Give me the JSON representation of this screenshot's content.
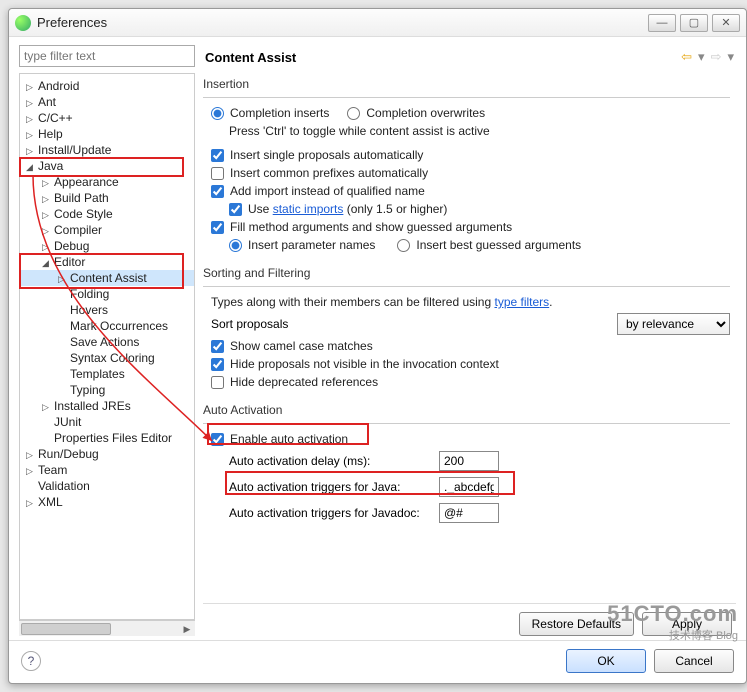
{
  "window": {
    "title": "Preferences"
  },
  "filter_placeholder": "type filter text",
  "tree": [
    {
      "label": "Android",
      "lvl": 0,
      "tw": "▷"
    },
    {
      "label": "Ant",
      "lvl": 0,
      "tw": "▷"
    },
    {
      "label": "C/C++",
      "lvl": 0,
      "tw": "▷"
    },
    {
      "label": "Help",
      "lvl": 0,
      "tw": "▷"
    },
    {
      "label": "Install/Update",
      "lvl": 0,
      "tw": "▷"
    },
    {
      "label": "Java",
      "lvl": 0,
      "tw": "◢",
      "hl": true
    },
    {
      "label": "Appearance",
      "lvl": 1,
      "tw": "▷"
    },
    {
      "label": "Build Path",
      "lvl": 1,
      "tw": "▷"
    },
    {
      "label": "Code Style",
      "lvl": 1,
      "tw": "▷"
    },
    {
      "label": "Compiler",
      "lvl": 1,
      "tw": "▷"
    },
    {
      "label": "Debug",
      "lvl": 1,
      "tw": "▷"
    },
    {
      "label": "Editor",
      "lvl": 1,
      "tw": "◢",
      "hl": true
    },
    {
      "label": "Content Assist",
      "lvl": 2,
      "tw": "▷",
      "sel": true,
      "hl": true
    },
    {
      "label": "Folding",
      "lvl": 2,
      "tw": ""
    },
    {
      "label": "Hovers",
      "lvl": 2,
      "tw": ""
    },
    {
      "label": "Mark Occurrences",
      "lvl": 2,
      "tw": ""
    },
    {
      "label": "Save Actions",
      "lvl": 2,
      "tw": ""
    },
    {
      "label": "Syntax Coloring",
      "lvl": 2,
      "tw": ""
    },
    {
      "label": "Templates",
      "lvl": 2,
      "tw": ""
    },
    {
      "label": "Typing",
      "lvl": 2,
      "tw": ""
    },
    {
      "label": "Installed JREs",
      "lvl": 1,
      "tw": "▷"
    },
    {
      "label": "JUnit",
      "lvl": 1,
      "tw": ""
    },
    {
      "label": "Properties Files Editor",
      "lvl": 1,
      "tw": ""
    },
    {
      "label": "Run/Debug",
      "lvl": 0,
      "tw": "▷"
    },
    {
      "label": "Team",
      "lvl": 0,
      "tw": "▷"
    },
    {
      "label": "Validation",
      "lvl": 0,
      "tw": ""
    },
    {
      "label": "XML",
      "lvl": 0,
      "tw": "▷"
    }
  ],
  "page_title": "Content Assist",
  "insertion": {
    "title": "Insertion",
    "radio_inserts": "Completion inserts",
    "radio_overwrites": "Completion overwrites",
    "ctrl_tip": "Press 'Ctrl' to toggle while content assist is active",
    "cb_single": "Insert single proposals automatically",
    "cb_prefix": "Insert common prefixes automatically",
    "cb_import": "Add import instead of qualified name",
    "cb_static_pre": "Use ",
    "cb_static_link": "static imports",
    "cb_static_post": " (only 1.5 or higher)",
    "cb_fill": "Fill method arguments and show guessed arguments",
    "radio_param": "Insert parameter names",
    "radio_best": "Insert best guessed arguments"
  },
  "sorting": {
    "title": "Sorting and Filtering",
    "desc_pre": "Types along with their members can be filtered using ",
    "desc_link": "type filters",
    "desc_post": ".",
    "sort_label": "Sort proposals",
    "sort_value": "by relevance",
    "cb_camel": "Show camel case matches",
    "cb_hide_inv": "Hide proposals not visible in the invocation context",
    "cb_hide_dep": "Hide deprecated references"
  },
  "auto": {
    "title": "Auto Activation",
    "cb_enable": "Enable auto activation",
    "delay_label": "Auto activation delay (ms):",
    "delay_value": "200",
    "java_label": "Auto activation triggers for Java:",
    "java_value": "._abcdefghijklmnopqrstuvwxyz",
    "javadoc_label": "Auto activation triggers for Javadoc:",
    "javadoc_value": "@#"
  },
  "buttons": {
    "restore": "Restore Defaults",
    "apply": "Apply",
    "ok": "OK",
    "cancel": "Cancel"
  },
  "watermark": {
    "big": "51CTO.com",
    "small": "技术博客 Blog"
  }
}
